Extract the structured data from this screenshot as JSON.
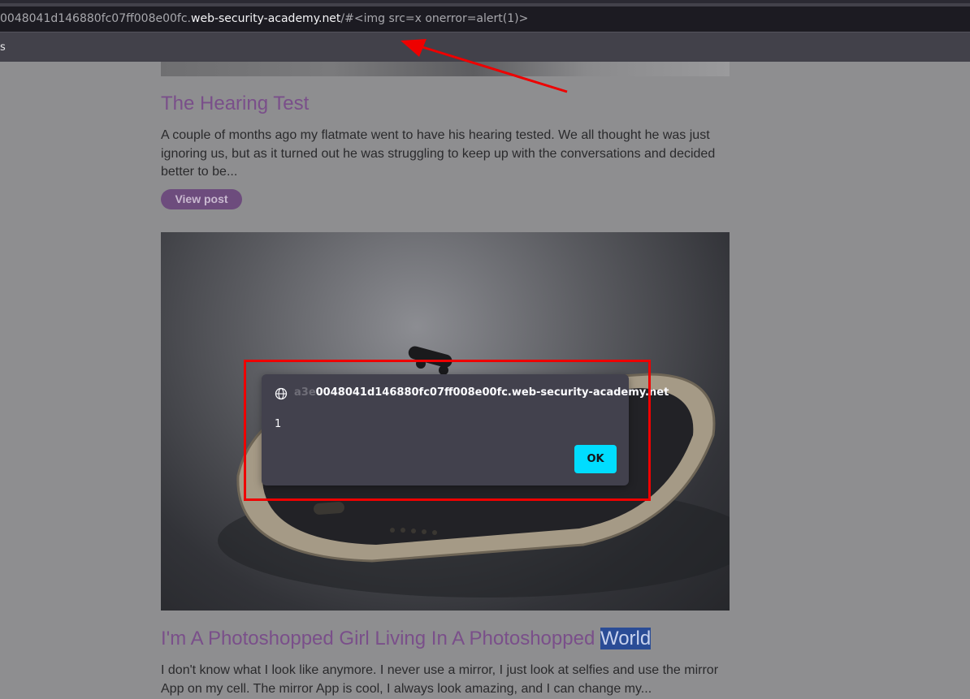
{
  "browser": {
    "url_prefix": "0048041d146880fc07ff008e00fc.",
    "url_host": "web-security-academy.net",
    "url_path": "/#<img src=x onerror=alert(1)>",
    "bookmarks_label": "s"
  },
  "posts": [
    {
      "title": "The Hearing Test",
      "excerpt": "A couple of months ago my flatmate went to have his hearing tested. We all thought he was just ignoring us, but as it turned out he was struggling to keep up with the conversations and decided better to be...",
      "button": "View post"
    },
    {
      "title_main": "I'm A Photoshopped Girl Living In A Photoshopped ",
      "title_highlight": "World",
      "excerpt": "I don't know what I look like anymore. I never use a mirror, I just look at selfies and use the mirror App on my cell. The mirror App is cool, I always look amazing, and I can change my..."
    }
  ],
  "dialog": {
    "origin_faded": "a3e",
    "origin": "0048041d146880fc07ff008e00fc.web-security-academy.net",
    "message": "1",
    "ok_label": "OK"
  },
  "colors": {
    "annotation": "#ee0000",
    "ok_button": "#00ddff",
    "post_title": "#7a4f8a"
  }
}
